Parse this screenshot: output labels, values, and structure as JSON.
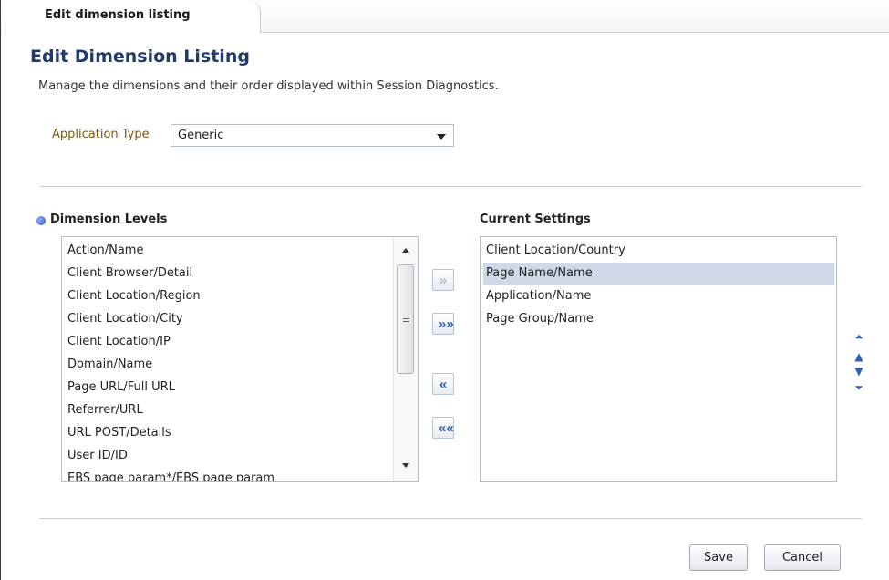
{
  "tab": {
    "label": "Edit dimension listing"
  },
  "page": {
    "title": "Edit Dimension Listing",
    "description": "Manage the dimensions and their order displayed within Session Diagnostics."
  },
  "application_type": {
    "label": "Application Type",
    "value": "Generic"
  },
  "dimension_levels": {
    "title": "Dimension Levels",
    "items": [
      "Action/Name",
      "Client Browser/Detail",
      "Client Location/Region",
      "Client Location/City",
      "Client Location/IP",
      "Domain/Name",
      "Page URL/Full URL",
      "Referrer/URL",
      "URL POST/Details",
      "User ID/ID",
      "EBS page param*/EBS page param"
    ]
  },
  "current_settings": {
    "title": "Current Settings",
    "items": [
      "Client Location/Country",
      "Page Name/Name",
      "Application/Name",
      "Page Group/Name"
    ],
    "selected_item": "Page Name/Name"
  },
  "shuttle": {
    "move": "»",
    "move_all": "»»",
    "remove": "«",
    "remove_all": "««"
  },
  "reorder": {
    "top": "⏶",
    "up": "▲",
    "down": "▼",
    "bottom": "⏷"
  },
  "buttons": {
    "save": "Save",
    "cancel": "Cancel"
  },
  "icons": {
    "section": "info-bullet-icon",
    "dropdown": "chevron-down-icon",
    "scroll_up": "scroll-up-arrow-icon",
    "scroll_down": "scroll-down-arrow-icon"
  },
  "colors": {
    "title": "#1f3a6b",
    "label": "#7b5a12",
    "accent": "#2f5fb8",
    "selection": "#cfd8e6"
  }
}
